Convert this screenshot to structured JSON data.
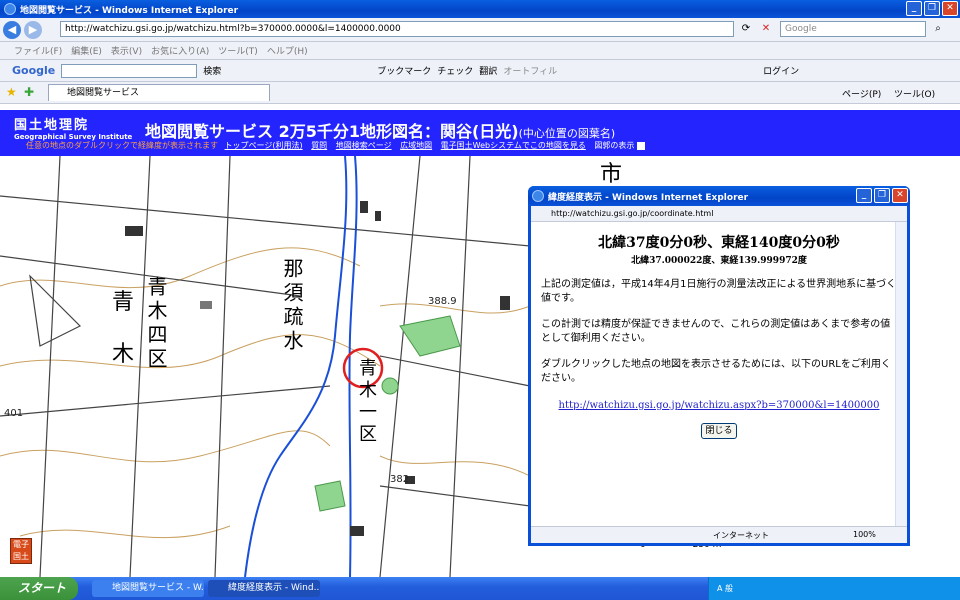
{
  "browser": {
    "title": "地図閲覧サービス - Windows Internet Explorer",
    "address": "http://watchizu.gsi.go.jp/watchizu.html?b=370000.0000&l=1400000.0000",
    "search_placeholder": "Google",
    "menu": [
      "ファイル(F)",
      "編集(E)",
      "表示(V)",
      "お気に入り(A)",
      "ツール(T)",
      "ヘルプ(H)"
    ],
    "google_toolbar": {
      "logo": "Google",
      "items": [
        "検索",
        "チェック",
        "翻訳",
        "オートフィル",
        "ブックマーク"
      ],
      "login": "ログイン"
    },
    "tab_label": "地図閲覧サービス",
    "command_bar": [
      "ページ(P)",
      "ツール(O)"
    ]
  },
  "site": {
    "logo_jp": "国土地理院",
    "logo_en": "Geographical Survey Institute",
    "title": "地図閲覧サービス 2万5千分1地形図名：関谷(日光)",
    "title_suffix": "(中心位置の図葉名)",
    "hint": "任意の地点のダブルクリックで経緯度が表示されます",
    "links": [
      "トップページ(利用法)",
      "質問",
      "地図検索ページ",
      "広域地図",
      "電子国土Webシステムでこの地図を見る",
      "図郭の表示"
    ]
  },
  "map": {
    "labels": [
      "青",
      "木",
      "青木四区",
      "那須疏水",
      "青木一区",
      "市"
    ],
    "heights": [
      "388.9",
      "382",
      "401"
    ],
    "scale_label": "250 m",
    "scale_zero": "0",
    "badge": "電子国土"
  },
  "popup": {
    "title": "緯度経度表示 - Windows Internet Explorer",
    "address": "http://watchizu.gsi.go.jp/coordinate.html",
    "heading": "北緯37度0分0秒、東経140度0分0秒",
    "subheading": "北緯37.000022度、東経139.999972度",
    "para1": "上記の測定値は，平成14年4月1日施行の測量法改正による世界測地系に基づく値です。",
    "para2": "この計測では精度が保証できませんので、これらの測定値はあくまで参考の値として御利用ください。",
    "para3": "ダブルクリックした地点の地図を表示させるためには、以下のURLをご利用ください。",
    "link": "http://watchizu.gsi.go.jp/watchizu.aspx?b=370000&l=1400000",
    "close_label": "閉じる",
    "status_zone": "インターネット",
    "status_zoom": "100%"
  },
  "taskbar": {
    "start": "スタート",
    "tasks": [
      "地図閲覧サービス - W...",
      "緯度経度表示 - Wind..."
    ],
    "tray_text": "A 般"
  },
  "colors": {
    "header_blue": "#2424ff",
    "river": "#1a4fd8",
    "contour": "#c9a060",
    "vegetation": "#8fd48f",
    "marker": "#e02020"
  }
}
